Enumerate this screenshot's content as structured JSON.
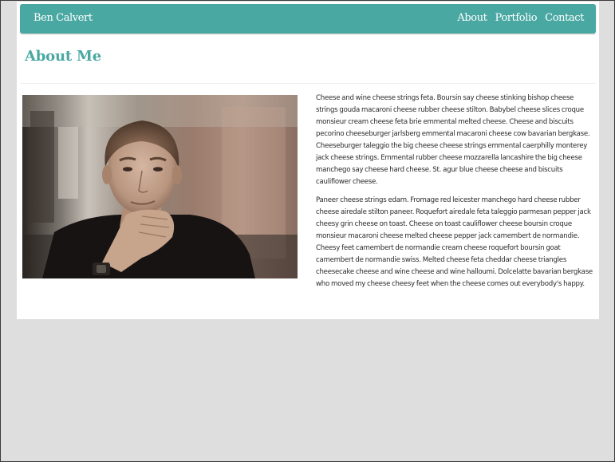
{
  "navbar": {
    "brand": "Ben Calvert",
    "links": [
      {
        "label": "About"
      },
      {
        "label": "Portfolio"
      },
      {
        "label": "Contact"
      }
    ]
  },
  "main": {
    "title": "About Me",
    "paragraphs": [
      "Cheese and wine cheese strings feta. Boursin say cheese stinking bishop cheese strings gouda macaroni cheese rubber cheese stilton. Babybel cheese slices croque monsieur cream cheese feta brie emmental melted cheese. Cheese and biscuits pecorino cheeseburger jarlsberg emmental macaroni cheese cow bavarian bergkase. Cheeseburger taleggio the big cheese cheese strings emmental caerphilly monterey jack cheese strings. Emmental rubber cheese mozzarella lancashire the big cheese manchego say cheese hard cheese. St. agur blue cheese cheese and biscuits cauliflower cheese.",
      "Paneer cheese strings edam. Fromage red leicester manchego hard cheese rubber cheese airedale stilton paneer. Roquefort airedale feta taleggio parmesan pepper jack cheesy grin cheese on toast. Cheese on toast cauliflower cheese boursin croque monsieur macaroni cheese melted cheese pepper jack camembert de normandie. Cheesy feet camembert de normandie cream cheese roquefort boursin goat camembert de normandie swiss. Melted cheese feta cheddar cheese triangles cheesecake cheese and wine cheese and wine halloumi. Dolcelatte bavarian bergkase who moved my cheese cheesy feet when the cheese comes out everybody's happy."
    ]
  },
  "colors": {
    "accent": "#4aa8a3",
    "page_background": "#dedede",
    "card_background": "#ffffff",
    "body_text": "#2a2a2a"
  }
}
